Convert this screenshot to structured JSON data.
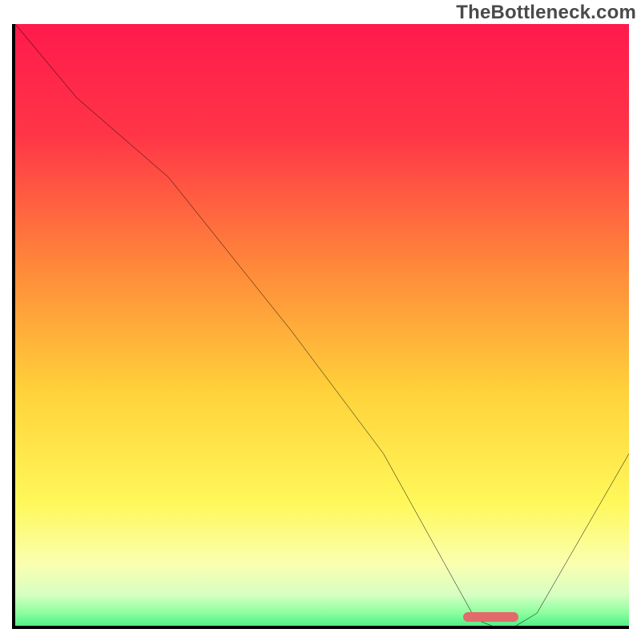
{
  "watermark": "TheBottleneck.com",
  "chart_data": {
    "type": "line",
    "title": "",
    "xlabel": "",
    "ylabel": "",
    "xlim": [
      0,
      100
    ],
    "ylim": [
      0,
      100
    ],
    "x": [
      0,
      10,
      25,
      45,
      60,
      70,
      75,
      80,
      85,
      100
    ],
    "values": [
      100,
      88,
      75,
      50,
      30,
      12,
      3,
      1,
      4,
      30
    ],
    "marker": {
      "x_start": 73,
      "x_end": 82,
      "y": 1
    },
    "gradient_stops": [
      {
        "pct": 0,
        "color": "#ff1a4c"
      },
      {
        "pct": 18,
        "color": "#ff3547"
      },
      {
        "pct": 40,
        "color": "#ff8a3a"
      },
      {
        "pct": 60,
        "color": "#ffd23a"
      },
      {
        "pct": 78,
        "color": "#fff85a"
      },
      {
        "pct": 88,
        "color": "#faffb0"
      },
      {
        "pct": 93,
        "color": "#d6ffc2"
      },
      {
        "pct": 96,
        "color": "#8aff9e"
      },
      {
        "pct": 100,
        "color": "#1adf73"
      }
    ]
  }
}
